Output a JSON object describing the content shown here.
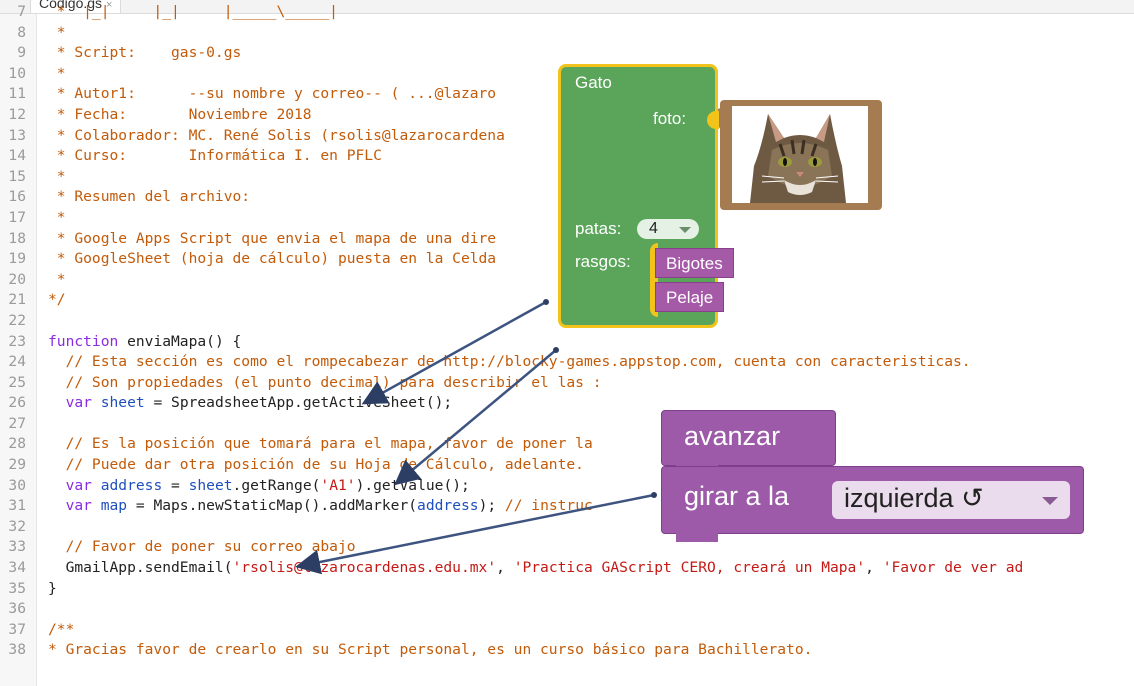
{
  "tab": {
    "filename": "Código.gs",
    "close": "×"
  },
  "code_lines": [
    {
      "n": "7",
      "text": " *  |_|     |_|     |_____\\_____|",
      "cls": "c"
    },
    {
      "n": "8",
      "text": " *",
      "cls": "c"
    },
    {
      "n": "9",
      "text": " * Script:    gas-0.gs",
      "cls": "c"
    },
    {
      "n": "10",
      "text": " *",
      "cls": "c"
    },
    {
      "n": "11",
      "text": " * Autor1:      --su nombre y correo-- ( ...@lazaro",
      "cls": "c"
    },
    {
      "n": "12",
      "text": " * Fecha:       Noviembre 2018",
      "cls": "c"
    },
    {
      "n": "13",
      "text": " * Colaborador: MC. René Solis (rsolis@lazarocardena",
      "cls": "c"
    },
    {
      "n": "14",
      "text": " * Curso:       Informática I. en PFLC",
      "cls": "c"
    },
    {
      "n": "15",
      "text": " *",
      "cls": "c"
    },
    {
      "n": "16",
      "text": " * Resumen del archivo:",
      "cls": "c"
    },
    {
      "n": "17",
      "text": " *",
      "cls": "c"
    },
    {
      "n": "18",
      "text": " * Google Apps Script que envia el mapa de una dire",
      "cls": "c"
    },
    {
      "n": "19",
      "text": " * GoogleSheet (hoja de cálculo) puesta en la Celda",
      "cls": "c"
    },
    {
      "n": "20",
      "text": " *",
      "cls": "c"
    },
    {
      "n": "21",
      "text": "*/",
      "cls": "c"
    },
    {
      "n": "22",
      "text": "",
      "cls": "df"
    },
    {
      "n": "23",
      "parts": [
        [
          "kw",
          "function"
        ],
        [
          "df",
          " enviaMapa() {"
        ]
      ]
    },
    {
      "n": "24",
      "text": "  // Esta sección es como el rompecabezar de http://blocky-games.appstop.com, cuenta con caracteristicas.",
      "cls": "c"
    },
    {
      "n": "25",
      "text": "  // Son propiedades (el punto decimal) para describir el las :",
      "cls": "c"
    },
    {
      "n": "26",
      "parts": [
        [
          "df",
          "  "
        ],
        [
          "kw",
          "var"
        ],
        [
          "df",
          " "
        ],
        [
          "vn",
          "sheet"
        ],
        [
          "df",
          " = SpreadsheetApp.getActiveSheet();"
        ]
      ]
    },
    {
      "n": "27",
      "text": "",
      "cls": "df"
    },
    {
      "n": "28",
      "text": "  // Es la posición que tomará para el mapa, favor de poner la",
      "cls": "c"
    },
    {
      "n": "29",
      "text": "  // Puede dar otra posición de su Hoja de Cálculo, adelante.",
      "cls": "c"
    },
    {
      "n": "30",
      "parts": [
        [
          "df",
          "  "
        ],
        [
          "kw",
          "var"
        ],
        [
          "df",
          " "
        ],
        [
          "vn",
          "address"
        ],
        [
          "df",
          " = "
        ],
        [
          "vn",
          "sheet"
        ],
        [
          "df",
          ".getRange("
        ],
        [
          "str",
          "'A1'"
        ],
        [
          "df",
          ").getValue();"
        ]
      ]
    },
    {
      "n": "31",
      "parts": [
        [
          "df",
          "  "
        ],
        [
          "kw",
          "var"
        ],
        [
          "df",
          " "
        ],
        [
          "vn",
          "map"
        ],
        [
          "df",
          " = Maps.newStaticMap().addMarker("
        ],
        [
          "vn",
          "address"
        ],
        [
          "df",
          "); "
        ],
        [
          "c",
          "// instruc"
        ]
      ]
    },
    {
      "n": "32",
      "text": "",
      "cls": "df"
    },
    {
      "n": "33",
      "text": "  // Favor de poner su correo abajo",
      "cls": "c"
    },
    {
      "n": "34",
      "parts": [
        [
          "df",
          "  GmailApp.sendEmail("
        ],
        [
          "str",
          "'rsolis@lazarocardenas.edu.mx'"
        ],
        [
          "df",
          ", "
        ],
        [
          "str",
          "'Practica GAScript CERO, creará un Mapa'"
        ],
        [
          "df",
          ", "
        ],
        [
          "str",
          "'Favor de ver ad"
        ]
      ]
    },
    {
      "n": "35",
      "text": "}",
      "cls": "df"
    },
    {
      "n": "36",
      "text": "",
      "cls": "df"
    },
    {
      "n": "37",
      "text": "/**",
      "cls": "c"
    },
    {
      "n": "38",
      "text": "* Gracias favor de crearlo en su Script personal, es un curso básico para Bachillerato.",
      "cls": "c"
    }
  ],
  "gato_block": {
    "title": "Gato",
    "foto_label": "foto:",
    "patas_label": "patas:",
    "patas_value": "4",
    "rasgos_label": "rasgos:",
    "rasgos": [
      "Bigotes",
      "Pelaje"
    ],
    "block_color": "#5ba55b",
    "border_color": "#f2c31b",
    "trait_color": "#a55aa8"
  },
  "motion_blocks": {
    "advance_label": "avanzar",
    "turn_label": "girar a la",
    "turn_value": "izquierda ↺",
    "color": "#9d5aa9"
  },
  "images": {
    "photo_icon": "cat-photo"
  }
}
